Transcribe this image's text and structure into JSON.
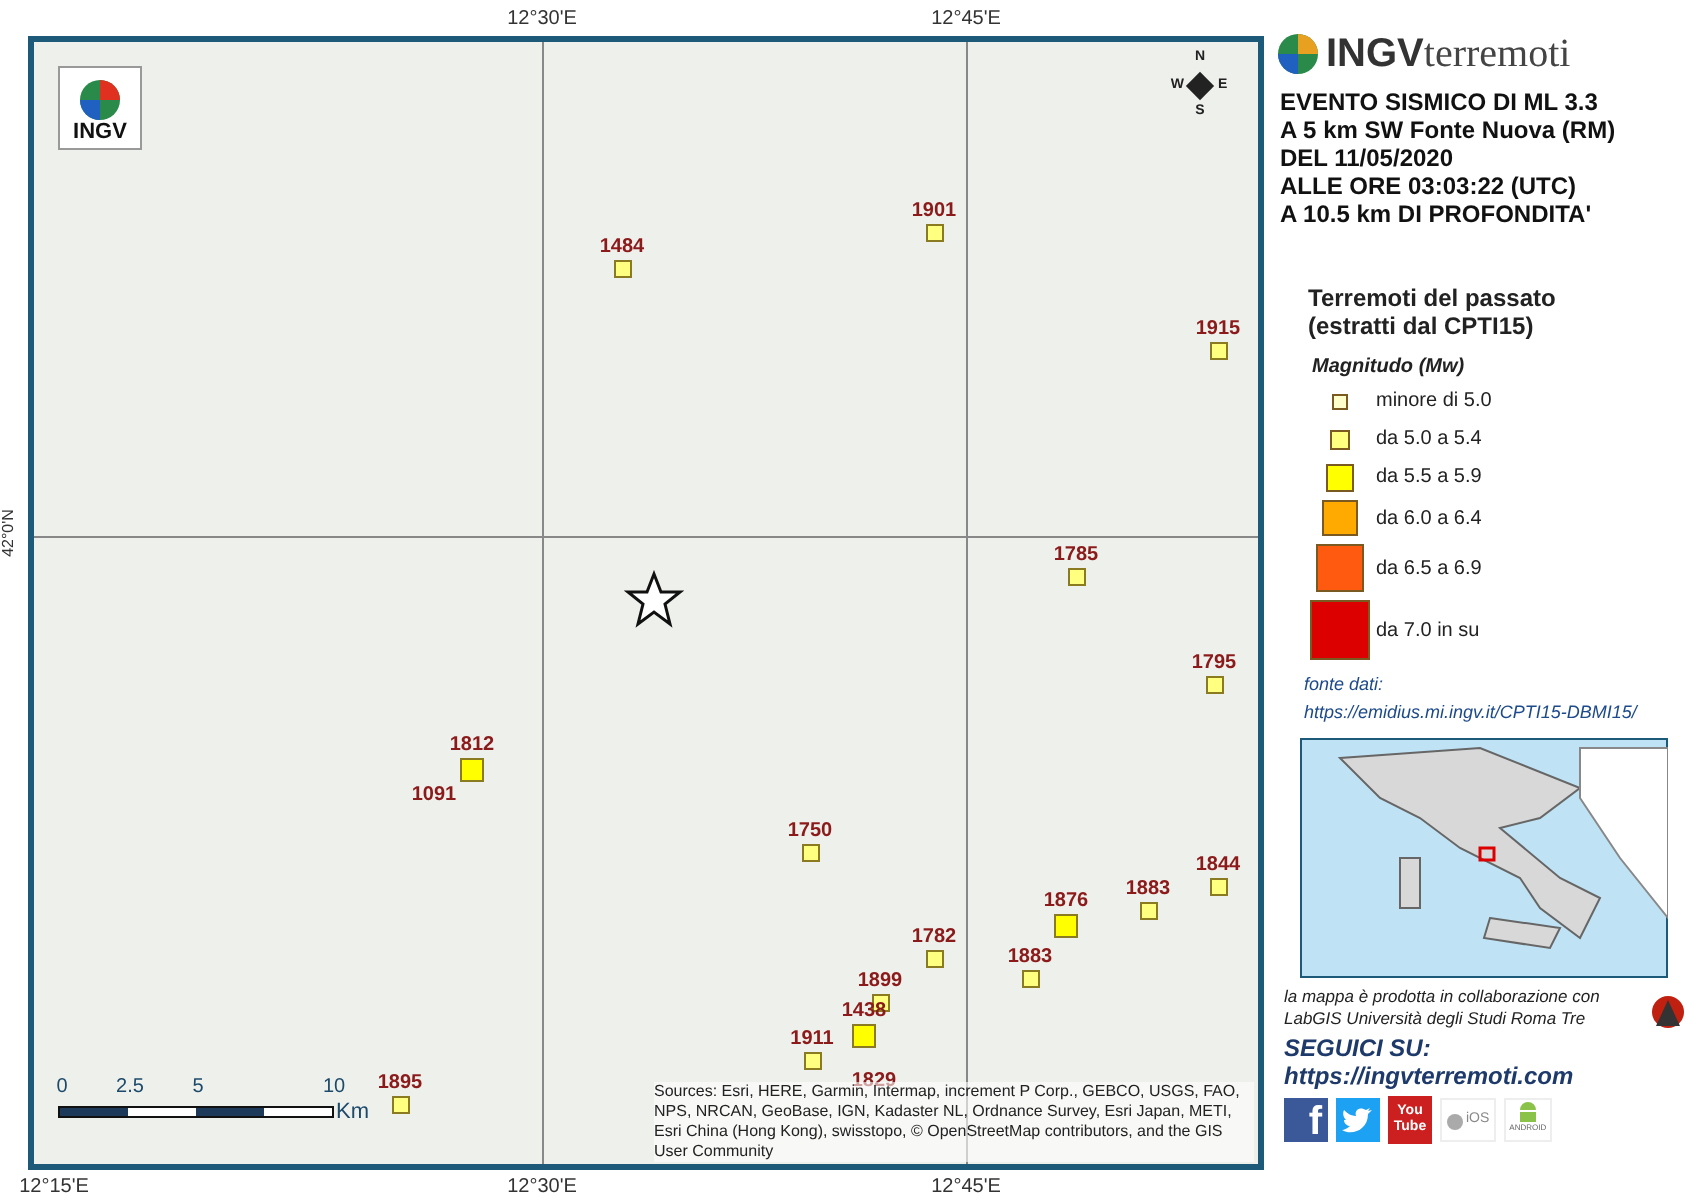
{
  "map": {
    "top_ticks": [
      "12°30'E",
      "12°45'E"
    ],
    "bottom_ticks": [
      "12°15'E",
      "12°30'E",
      "12°45'E"
    ],
    "left_ticks": [
      "42°0'N"
    ],
    "logo": "INGV",
    "scale": {
      "labels": [
        "0",
        "2.5",
        "5",
        "10"
      ],
      "unit": "Km"
    },
    "attribution": "Sources: Esri, HERE, Garmin, Intermap, increment P Corp., GEBCO, USGS, FAO, NPS, NRCAN, GeoBase, IGN, Kadaster NL, Ordnance Survey, Esri Japan, METI, Esri China (Hong Kong), swisstopo, © OpenStreetMap contributors, and the GIS User Community",
    "compass": {
      "n": "N",
      "s": "S",
      "w": "W",
      "e": "E"
    },
    "events": [
      {
        "year": "1484",
        "kind": "m50"
      },
      {
        "year": "1901",
        "kind": "m50"
      },
      {
        "year": "1915",
        "kind": "m50"
      },
      {
        "year": "1785",
        "kind": "m50"
      },
      {
        "year": "1795",
        "kind": "m50"
      },
      {
        "year": "1812",
        "kind": "m55"
      },
      {
        "year": "1091",
        "kind": "none"
      },
      {
        "year": "1750",
        "kind": "m50"
      },
      {
        "year": "1844",
        "kind": "m50"
      },
      {
        "year": "1883",
        "kind": "m50"
      },
      {
        "year": "1876",
        "kind": "m55"
      },
      {
        "year": "1782",
        "kind": "m50"
      },
      {
        "year": "1883",
        "kind": "m50"
      },
      {
        "year": "1899",
        "kind": "m50"
      },
      {
        "year": "1438",
        "kind": "m55"
      },
      {
        "year": "1911",
        "kind": "m50"
      },
      {
        "year": "1829",
        "kind": "none"
      },
      {
        "year": "1895",
        "kind": "m50"
      }
    ]
  },
  "panel": {
    "brand_bold": "INGV",
    "brand_light": "terremoti",
    "event_lines": [
      "EVENTO SISMICO DI ML 3.3",
      "A 5 km SW Fonte Nuova (RM)",
      "DEL 11/05/2020",
      "ALLE ORE 03:03:22 (UTC)",
      "A 10.5 km DI PROFONDITA'"
    ],
    "legend_title": [
      "Terremoti del passato",
      "(estratti dal CPTI15)"
    ],
    "legend_subtitle": "Magnitudo (Mw)",
    "legend": [
      {
        "label": "minore di 5.0",
        "kind": "m40",
        "color": "#ffffcc"
      },
      {
        "label": "da 5.0 a 5.4",
        "kind": "m50",
        "color": "#ffff80"
      },
      {
        "label": "da 5.5 a 5.9",
        "kind": "m55",
        "color": "#ffff00"
      },
      {
        "label": "da 6.0 a 6.4",
        "kind": "m60",
        "color": "#ffaa00"
      },
      {
        "label": "da 6.5 a 6.9",
        "kind": "m65",
        "color": "#ff5a10"
      },
      {
        "label": "da 7.0 in su",
        "kind": "m70",
        "color": "#dd0000"
      }
    ],
    "source_label": "fonte dati:",
    "source_url": "https://emidius.mi.ingv.it/CPTI15-DBMI15/",
    "credit": "la mappa è prodotta in collaborazione con LabGIS Università degli Studi Roma Tre",
    "follow": "SEGUICI SU:",
    "follow_url": "https://ingvterremoti.com",
    "social": [
      {
        "kind": "facebook",
        "label": "f"
      },
      {
        "kind": "twitter"
      },
      {
        "kind": "youtube",
        "label": "You Tube"
      },
      {
        "kind": "ios",
        "label": "iOS"
      },
      {
        "kind": "android",
        "label": "ANDROID"
      }
    ]
  }
}
